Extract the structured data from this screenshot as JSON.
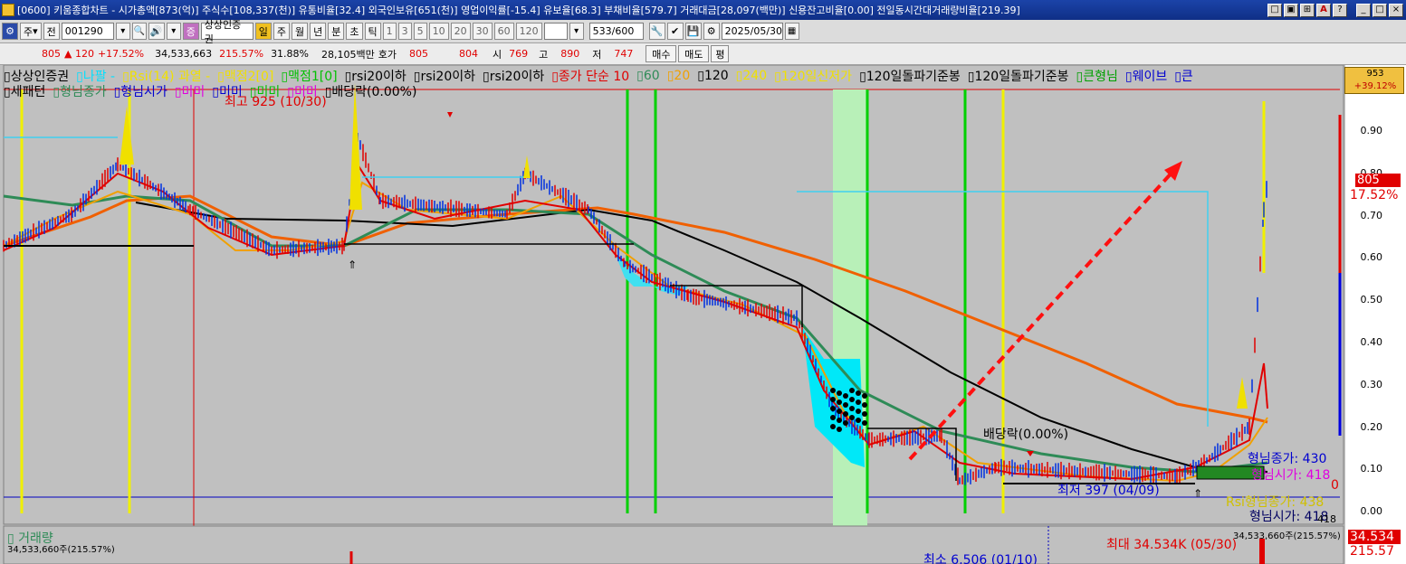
{
  "window": {
    "title": "[0600] 키움종합차트 - 시가총액[873(억)] 주식수[108,337(천)] 유통비율[32.4] 외국인보유[651(천)] 영업이익률[-15.4] 유보율[68.3] 부채비율[579.7] 거래대금[28,097(백만)] 신용잔고비율[0.00] 전일동시간대거래량비율[219.39]",
    "buttons": [
      "□",
      "▣",
      "⊞",
      "A",
      "?",
      "_",
      "□",
      "×"
    ]
  },
  "toolbar": {
    "type_select": "주",
    "prev_label": "전",
    "code_value": "001290",
    "stock_name": "상상인증권",
    "period_buttons": [
      "일",
      "주",
      "월",
      "년",
      "분",
      "초",
      "틱"
    ],
    "interval_buttons": [
      "1",
      "3",
      "5",
      "10",
      "20",
      "30",
      "60",
      "120"
    ],
    "count_value": "533",
    "count_total": "/600",
    "date_value": "2025/05/30",
    "price_current": "805",
    "price_change": "▲ 120",
    "price_change_pct": "+17.52%",
    "volume": "34,533,663",
    "volume_ratio": "215.57%",
    "turnover": "31.88%",
    "trade_value": "28,105백만",
    "quote_label": "호가",
    "quote_ask": "805",
    "quote_bid": "804",
    "open_label": "시",
    "open_value": "769",
    "high_label": "고",
    "high_value": "890",
    "low_label": "저",
    "low_value": "747",
    "buy_label": "매수",
    "sell_label": "매도",
    "eval_label": "평"
  },
  "chart": {
    "legend1": {
      "items": [
        {
          "text": "상상인증권",
          "color": "#000000"
        },
        {
          "text": "나팔 -",
          "color": "#00e0ff"
        },
        {
          "text": "Rsi(14) 과열 -",
          "color": "#f0e000"
        },
        {
          "text": "맥점2[0]",
          "color": "#f0e000"
        },
        {
          "text": "맥점1[0]",
          "color": "#00c000"
        },
        {
          "text": "rsi20이하",
          "color": "#000000"
        },
        {
          "text": "rsi20이하",
          "color": "#000000"
        },
        {
          "text": "rsi20이하",
          "color": "#000000"
        },
        {
          "text": "종가 단순 10",
          "color": "#e00000"
        },
        {
          "text": "60",
          "color": "#2e8b57"
        },
        {
          "text": "20",
          "color": "#f0a000"
        },
        {
          "text": "120",
          "color": "#000000"
        },
        {
          "text": "240",
          "color": "#f0e000"
        },
        {
          "text": "120일신저가",
          "color": "#f0e000"
        },
        {
          "text": "120일돌파기준봉",
          "color": "#000000"
        },
        {
          "text": "120일돌파기준봉",
          "color": "#000000"
        },
        {
          "text": "큰형님",
          "color": "#00a000"
        },
        {
          "text": "웨이브",
          "color": "#0000d0"
        },
        {
          "text": "큰",
          "color": "#0000d0"
        }
      ]
    },
    "legend2": {
      "items": [
        {
          "text": "세패턴",
          "color": "#000000"
        },
        {
          "text": "형님종가",
          "color": "#2e8b57"
        },
        {
          "text": "형님시가",
          "color": "#0000d0"
        },
        {
          "text": "미미",
          "color": "#e000e0"
        },
        {
          "text": "미미",
          "color": "#0000d0"
        },
        {
          "text": "미미",
          "color": "#00c000"
        },
        {
          "text": "미미",
          "color": "#e000e0"
        },
        {
          "text": "배당락(0.00%)",
          "color": "#000000"
        }
      ]
    },
    "annotations": {
      "high_label": "최고 925 (10/30)",
      "low_label": "최저 397 (04/09)",
      "dividend_label": "배당락(0.00%)",
      "hyungnim_close_1": "형님종가: 430",
      "hyungnim_open_1": "형님시가: 418",
      "rsi_hyungnim_close": "Rsi형님종가: 438",
      "hyungnim_open_2": "형님시가: 418",
      "zero_label": "0",
      "extra_418": "418"
    },
    "axis": {
      "badge_top_line1": "953",
      "badge_top_line2": "+39.12%",
      "ticks": [
        "0.90",
        "0.80",
        "0.70",
        "0.60",
        "0.50",
        "0.40",
        "0.30",
        "0.20",
        "0.10",
        "0.00"
      ],
      "current_price": "805",
      "current_pct": "17.52%"
    },
    "volume": {
      "title": "거래량",
      "left_value": "34,533,660주(215.57%)",
      "right_value": "34,533,660주(215.57%)",
      "max_label": "최대 34.534K (05/30)",
      "min_label": "최소 6,506 (01/10)",
      "badge1": "34.534",
      "badge2": "215.57"
    }
  }
}
